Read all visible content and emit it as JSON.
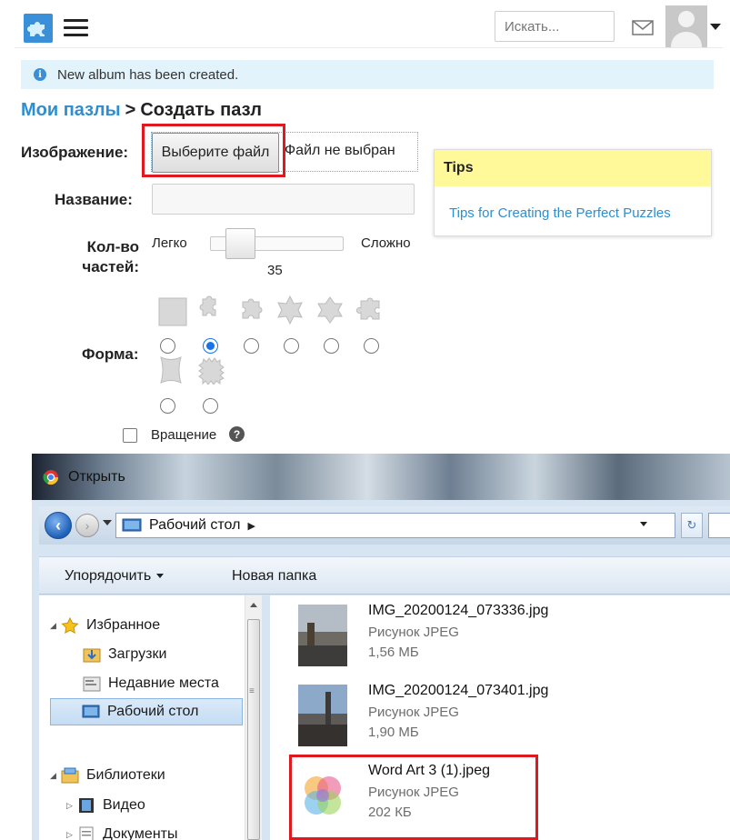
{
  "topbar": {
    "logo_icon": "puzzle-logo-icon",
    "menu_icon": "hamburger-menu-icon",
    "search_placeholder": "Искать...",
    "mail_icon": "envelope-icon",
    "user_icon": "user-avatar-icon",
    "caret_icon": "caret-down-icon"
  },
  "alert": {
    "text": "New album has been created.",
    "icon": "info-icon",
    "bg_color": "#e3f3fb"
  },
  "breadcrumb": {
    "parent": "Мои пазлы",
    "separator": ">",
    "current": "Создать пазл",
    "link_color": "#2e8ecf"
  },
  "form": {
    "image_label": "Изображение:",
    "file_button": "Выберите файл",
    "file_status": "Файл не выбран",
    "name_label": "Название:",
    "name_value": "",
    "pieces_label_1": "Кол-во",
    "pieces_label_2": "частей:",
    "slider_min_label": "Легко",
    "slider_max_label": "Сложно",
    "slider_value": "35",
    "slider_fraction": 0.12,
    "shape_label": "Форма:",
    "shapes": [
      {
        "name": "square",
        "selected": false
      },
      {
        "name": "classic",
        "selected": true
      },
      {
        "name": "tabbed",
        "selected": false
      },
      {
        "name": "star",
        "selected": false
      },
      {
        "name": "flower",
        "selected": false
      },
      {
        "name": "rounded",
        "selected": false
      },
      {
        "name": "curved",
        "selected": false
      },
      {
        "name": "jagged",
        "selected": false
      }
    ],
    "rotation_label": "Вращение",
    "rotation_checked": false,
    "help_icon": "question-circle-icon",
    "highlight_color": "#e0181f"
  },
  "tips": {
    "title": "Tips",
    "link": "Tips for Creating the Perfect Puzzles",
    "header_color": "#fff99a"
  },
  "dialog": {
    "title": "Открыть",
    "address": "Рабочий стол",
    "toolbar": {
      "organize": "Упорядочить",
      "new_folder": "Новая папка"
    },
    "nav": {
      "favorites": "Избранное",
      "downloads": "Загрузки",
      "recent": "Недавние места",
      "desktop": "Рабочий стол",
      "libraries": "Библиотеки",
      "video": "Видео",
      "documents": "Документы"
    },
    "files": [
      {
        "name": "IMG_20200124_073336.jpg",
        "type": "Рисунок JPEG",
        "size": "1,56 МБ",
        "highlighted": false
      },
      {
        "name": "IMG_20200124_073401.jpg",
        "type": "Рисунок JPEG",
        "size": "1,90 МБ",
        "highlighted": false
      },
      {
        "name": "Word Art 3 (1).jpeg",
        "type": "Рисунок JPEG",
        "size": "202 КБ",
        "highlighted": true
      }
    ]
  }
}
